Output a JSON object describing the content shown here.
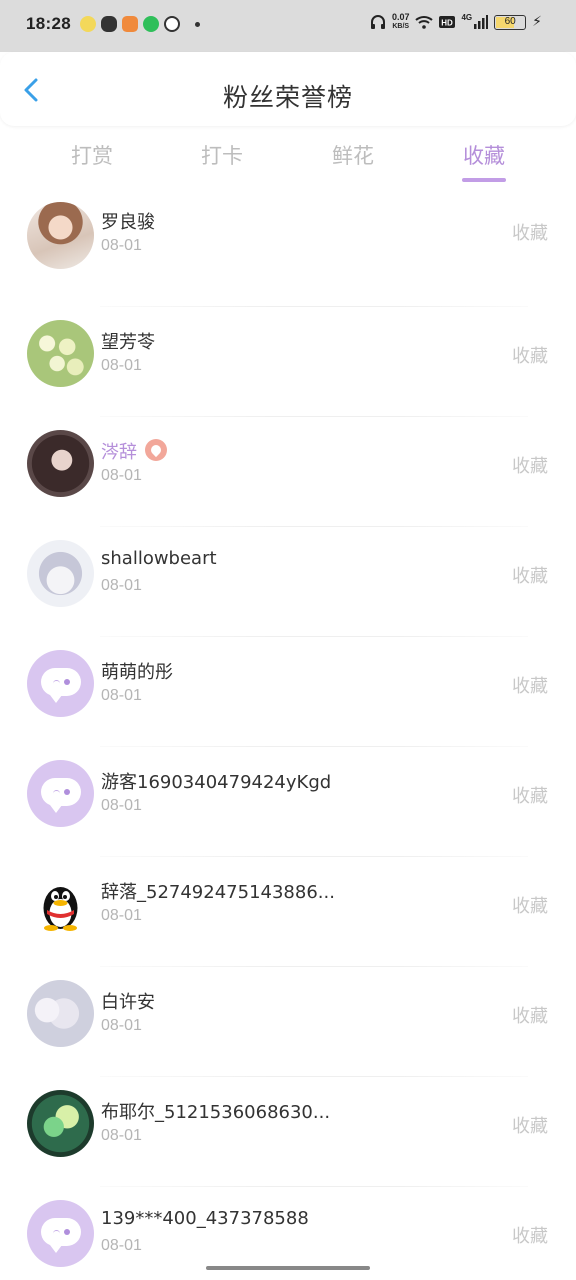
{
  "status_bar": {
    "time": "18:28",
    "speed_value": "0.07",
    "speed_unit": "KB/S",
    "battery": "60",
    "network": "4G"
  },
  "header": {
    "title": "粉丝荣誉榜"
  },
  "tabs": [
    {
      "label": "打赏",
      "active": false
    },
    {
      "label": "打卡",
      "active": false
    },
    {
      "label": "鲜花",
      "active": false
    },
    {
      "label": "收藏",
      "active": true
    }
  ],
  "fans": [
    {
      "name": "罗良骏",
      "date": "08-01",
      "action": "收藏",
      "avatar": "photo-girl"
    },
    {
      "name": "望芳苓",
      "date": "08-01",
      "action": "收藏",
      "avatar": "photo-flowers"
    },
    {
      "name": "涔辞",
      "date": "08-01",
      "action": "收藏",
      "avatar": "photo-anime-dark",
      "vip": true
    },
    {
      "name": "shallowbeart",
      "date": "08-01",
      "action": "收藏",
      "avatar": "photo-anime-bunny"
    },
    {
      "name": "萌萌的彤",
      "date": "08-01",
      "action": "收藏",
      "avatar": "default-chat-bubble"
    },
    {
      "name": "游客1690340479424yKgd",
      "date": "08-01",
      "action": "收藏",
      "avatar": "default-chat-bubble"
    },
    {
      "name": "辞落_527492475143886...",
      "date": "08-01",
      "action": "收藏",
      "avatar": "qq-penguin"
    },
    {
      "name": "白许安",
      "date": "08-01",
      "action": "收藏",
      "avatar": "photo-anime-white"
    },
    {
      "name": "布耶尔_5121536068630...",
      "date": "08-01",
      "action": "收藏",
      "avatar": "photo-green-glow"
    },
    {
      "name": "139***400_437378588",
      "date": "08-01",
      "action": "收藏",
      "avatar": "default-chat-bubble"
    }
  ],
  "colors": {
    "accent": "#b58fda",
    "muted": "#c8c8c8",
    "back_arrow": "#3aa0e8"
  }
}
